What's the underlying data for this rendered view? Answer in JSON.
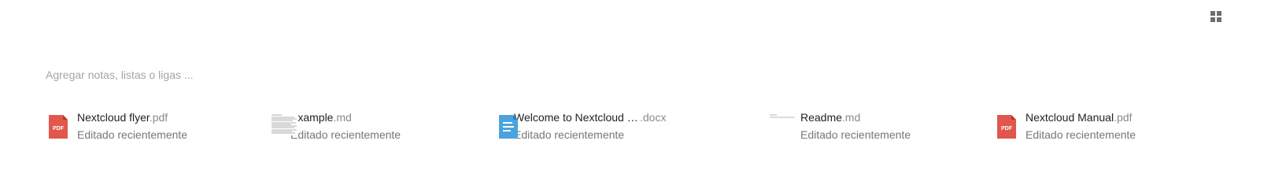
{
  "notes": {
    "placeholder": "Agregar notas, listas o ligas ..."
  },
  "view_toggle": {
    "icon": "grid-view-icon"
  },
  "recent_files": [
    {
      "name": "Nextcloud flyer",
      "ext": ".pdf",
      "subtitle": "Editado recientemente",
      "icon": "pdf-icon",
      "color": "#e2574c"
    },
    {
      "name": "Example",
      "ext": ".md",
      "subtitle": "Editado recientemente",
      "icon": "text-preview-thumbnail"
    },
    {
      "name": "Welcome to Nextcloud H...",
      "ext": ".docx",
      "subtitle": "Editado recientemente",
      "icon": "document-icon",
      "color": "#4aa3df"
    },
    {
      "name": "Readme",
      "ext": ".md",
      "subtitle": "Editado recientemente",
      "icon": "text-preview-thumbnail"
    },
    {
      "name": "Nextcloud Manual",
      "ext": ".pdf",
      "subtitle": "Editado recientemente",
      "icon": "pdf-icon",
      "color": "#e2574c"
    }
  ]
}
